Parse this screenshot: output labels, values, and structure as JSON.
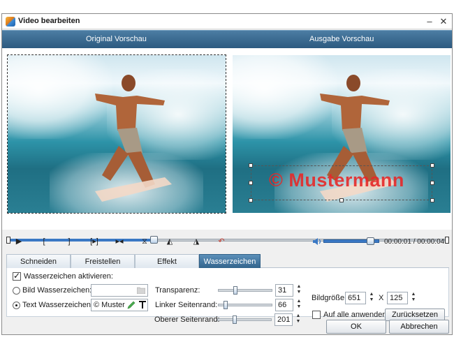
{
  "window": {
    "title": "Video bearbeiten",
    "minimize_glyph": "–",
    "close_glyph": "✕"
  },
  "preview": {
    "original_label": "Original Vorschau",
    "output_label": "Ausgabe Vorschau",
    "watermark_text": "© Mustermann"
  },
  "playback": {
    "time_display": "00:00:01 / 00:00:04",
    "timeline_progress": 0.33,
    "volume_level": 0.85,
    "controls": [
      {
        "name": "play-button",
        "glyph": "▶"
      },
      {
        "name": "mark-in-button",
        "glyph": "["
      },
      {
        "name": "mark-out-button",
        "glyph": "]"
      },
      {
        "name": "jump-in-button",
        "glyph": "[▸]"
      },
      {
        "name": "jump-out-button",
        "glyph": "▸◂"
      },
      {
        "name": "hourglass-button",
        "glyph": "⧖"
      },
      {
        "name": "rotate-left-button",
        "glyph": "◭"
      },
      {
        "name": "flip-button",
        "glyph": "◮"
      },
      {
        "name": "undo-button",
        "glyph": "↶"
      }
    ]
  },
  "tabs": [
    {
      "label": "Schneiden",
      "active": false
    },
    {
      "label": "Freistellen",
      "active": false
    },
    {
      "label": "Effekt",
      "active": false
    },
    {
      "label": "Wasserzeichen",
      "active": true
    }
  ],
  "watermark": {
    "enable_label": "Wasserzeichen aktivieren:",
    "enabled": true,
    "image_option_label": "Bild Wasserzeichen:",
    "image_path_value": "",
    "text_option_label": "Text Wasserzeichen:",
    "text_value": "© Muster",
    "selected_option": "text",
    "transparency_label": "Transparenz:",
    "transparency_value": "31",
    "left_margin_label": "Linker Seitenrand:",
    "left_margin_value": "66",
    "top_margin_label": "Oberer Seitenrand:",
    "top_margin_value": "201",
    "size_label": "Bildgröße:",
    "size_width": "651",
    "size_separator": "X",
    "size_height": "125",
    "apply_all_label": "Auf alle anwenden",
    "apply_all_checked": false,
    "reset_label": "Zurücksetzen"
  },
  "footer": {
    "ok_label": "OK",
    "cancel_label": "Abbrechen"
  },
  "colors": {
    "accent_blue": "#3a78c4",
    "header_bar": "#2c5a80",
    "watermark_red": "#e62828"
  }
}
